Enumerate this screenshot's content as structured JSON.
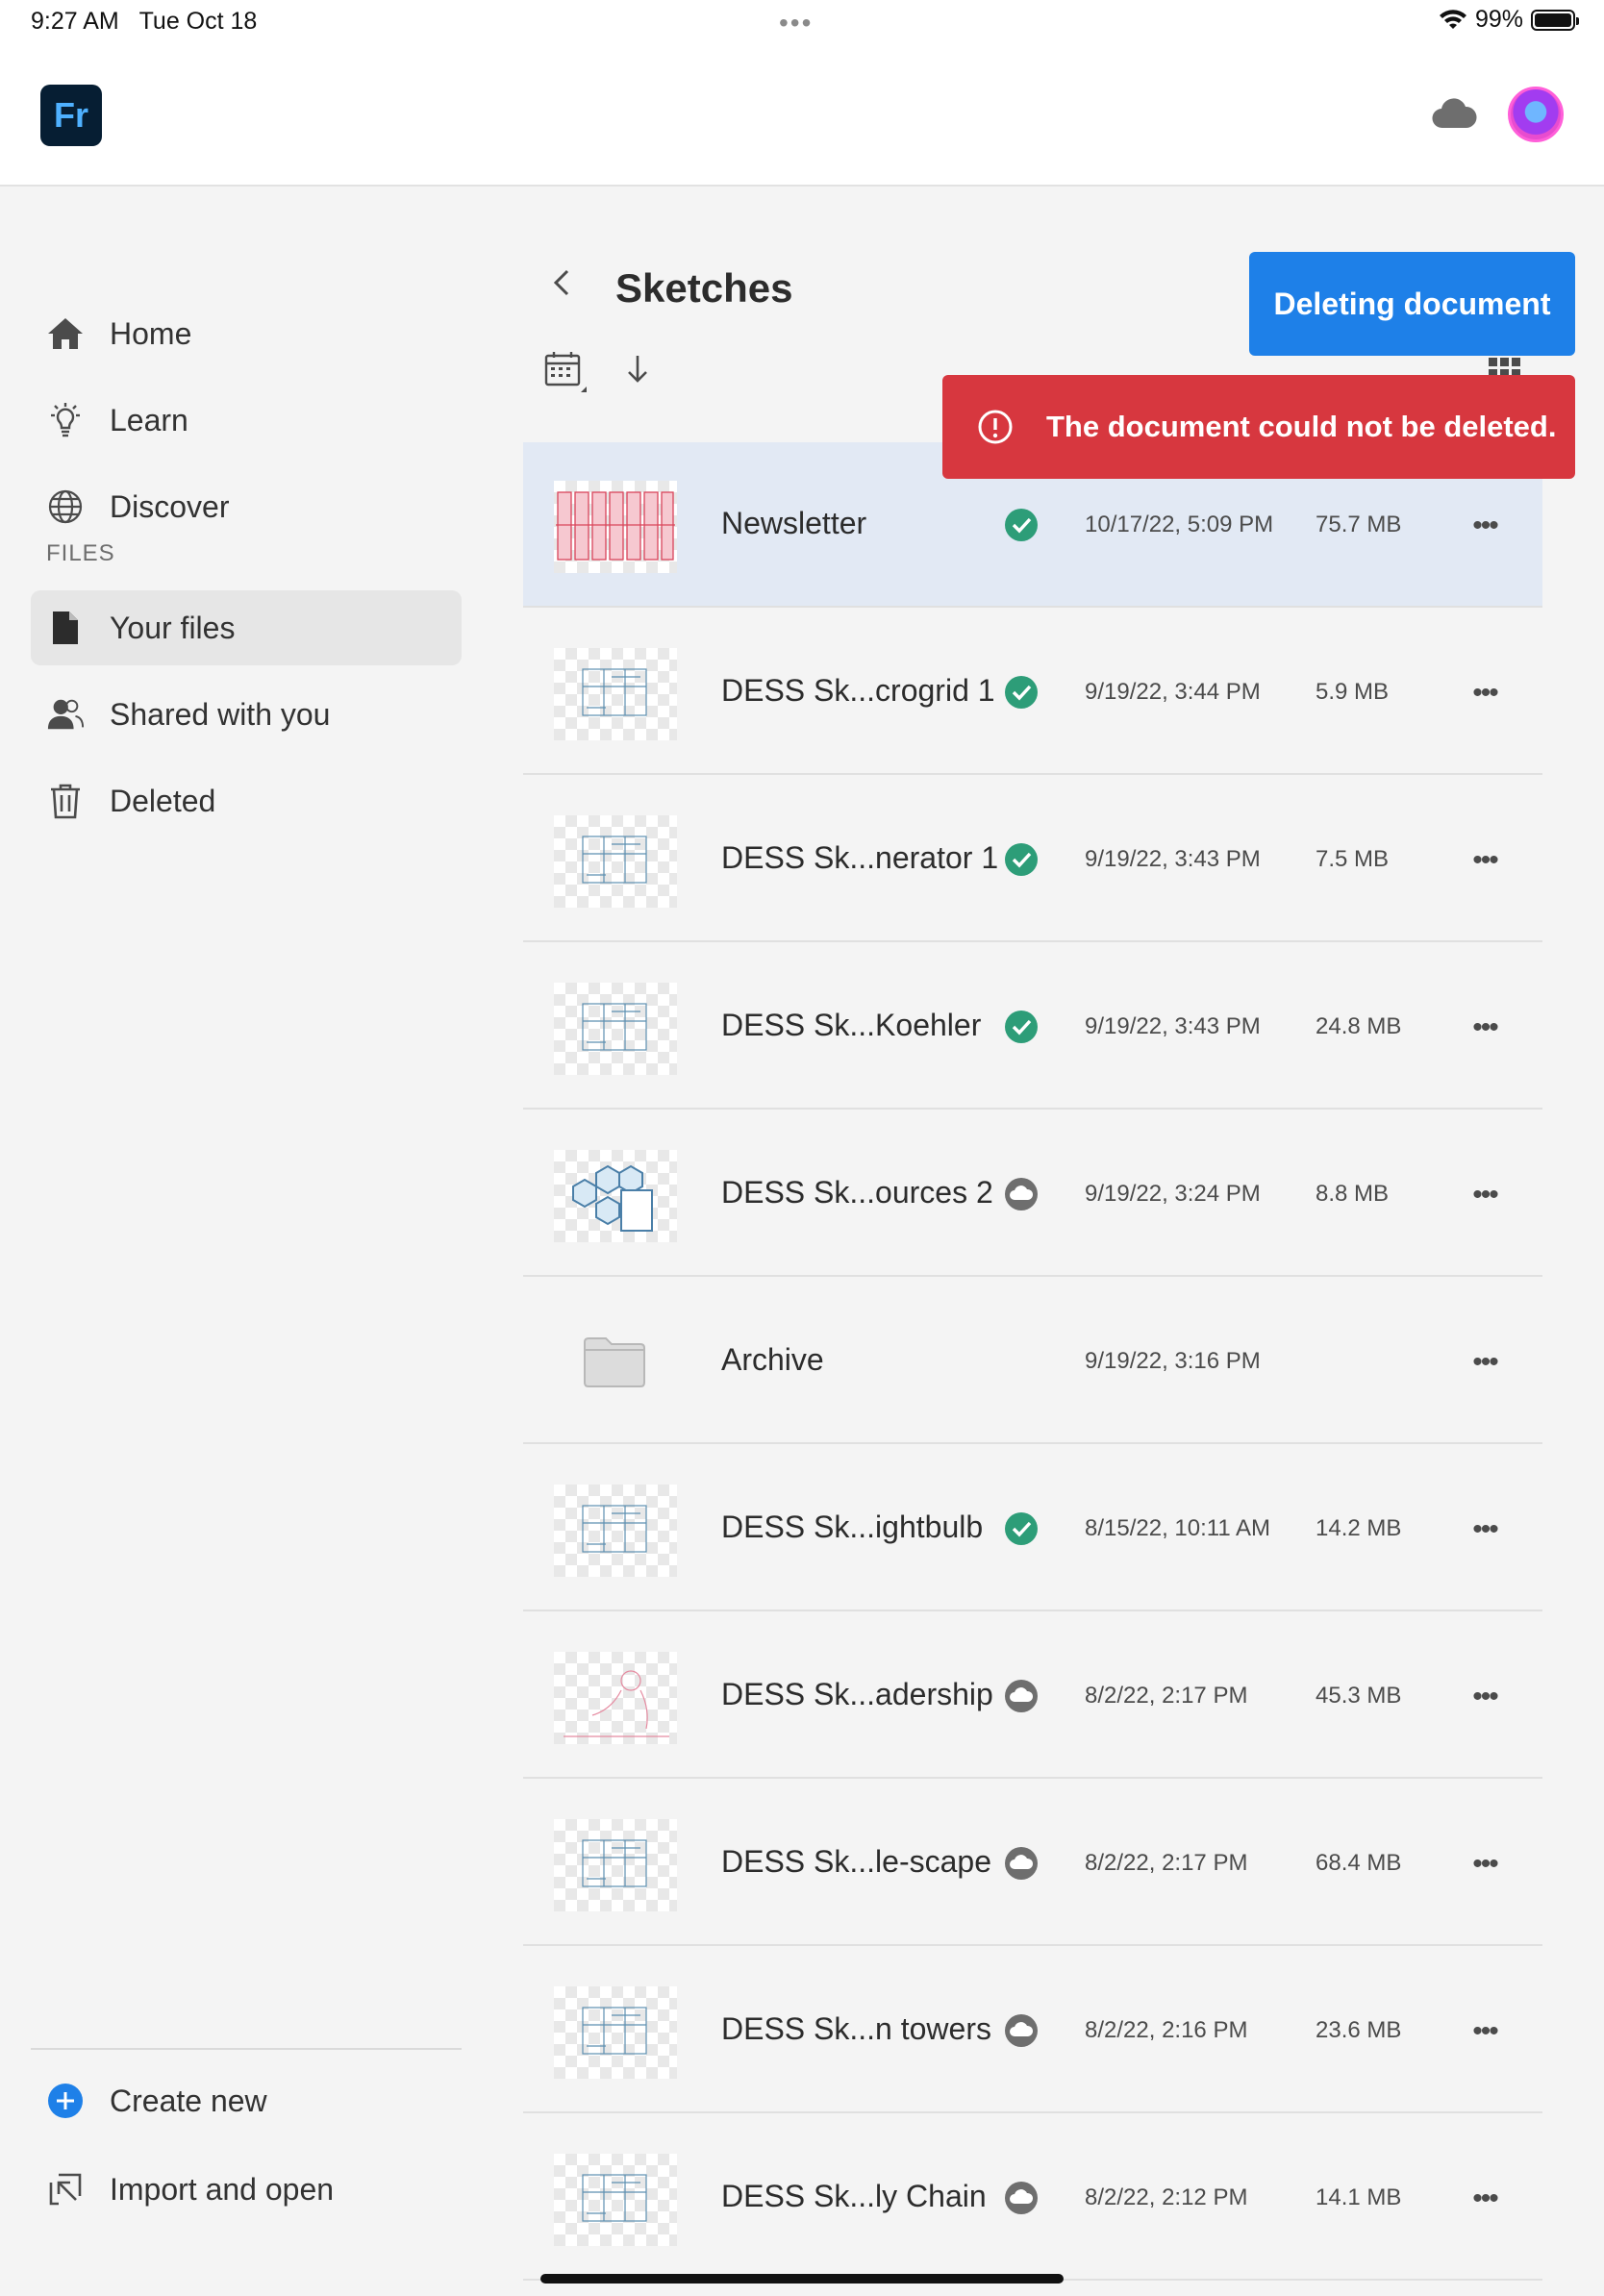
{
  "status_bar": {
    "time": "9:27 AM",
    "date": "Tue Oct 18",
    "dots": "•••",
    "battery": "99%",
    "icons": [
      "wifi-icon",
      "battery-icon"
    ]
  },
  "app": {
    "logo_text": "Fr",
    "cloud_icon": "cloud-icon",
    "avatar_icon": "user-avatar"
  },
  "sidebar": {
    "nav": [
      {
        "label": "Home",
        "icon": "home-icon"
      },
      {
        "label": "Learn",
        "icon": "lightbulb-icon"
      },
      {
        "label": "Discover",
        "icon": "globe-icon"
      }
    ],
    "files_header": "FILES",
    "files": [
      {
        "label": "Your files",
        "icon": "document-icon",
        "active": true
      },
      {
        "label": "Shared with you",
        "icon": "people-icon"
      },
      {
        "label": "Deleted",
        "icon": "trash-icon"
      }
    ],
    "bottom": [
      {
        "label": "Create new",
        "icon": "plus-circle-icon"
      },
      {
        "label": "Import and open",
        "icon": "import-icon"
      }
    ]
  },
  "main": {
    "title": "Sketches",
    "deleting_button": "Deleting document",
    "toast_message": "The document could not be deleted.",
    "more_label": "•••",
    "rows": [
      {
        "name": "Newsletter",
        "sync": "synced",
        "date": "10/17/22, 5:09 PM",
        "size": "75.7 MB",
        "thumb": "red"
      },
      {
        "name": "DESS Sk...crogrid 1",
        "sync": "synced",
        "date": "9/19/22, 3:44 PM",
        "size": "5.9 MB",
        "thumb": "blue"
      },
      {
        "name": "DESS Sk...nerator 1",
        "sync": "synced",
        "date": "9/19/22, 3:43 PM",
        "size": "7.5 MB",
        "thumb": "blue"
      },
      {
        "name": "DESS Sk...Koehler",
        "sync": "synced",
        "date": "9/19/22, 3:43 PM",
        "size": "24.8 MB",
        "thumb": "blue"
      },
      {
        "name": "DESS Sk...ources 2",
        "sync": "cloud",
        "date": "9/19/22, 3:24 PM",
        "size": "8.8 MB",
        "thumb": "hex"
      },
      {
        "name": "Archive",
        "sync": "",
        "date": "9/19/22, 3:16 PM",
        "size": "",
        "thumb": "folder"
      },
      {
        "name": "DESS Sk...ightbulb",
        "sync": "synced",
        "date": "8/15/22, 10:11 AM",
        "size": "14.2 MB",
        "thumb": "blue"
      },
      {
        "name": "DESS Sk...adership",
        "sync": "cloud",
        "date": "8/2/22, 2:17 PM",
        "size": "45.3 MB",
        "thumb": "pink"
      },
      {
        "name": "DESS Sk...le-scape",
        "sync": "cloud",
        "date": "8/2/22, 2:17 PM",
        "size": "68.4 MB",
        "thumb": "blue"
      },
      {
        "name": "DESS Sk...n towers",
        "sync": "cloud",
        "date": "8/2/22, 2:16 PM",
        "size": "23.6 MB",
        "thumb": "blue"
      },
      {
        "name": "DESS Sk...ly Chain",
        "sync": "cloud",
        "date": "8/2/22, 2:12 PM",
        "size": "14.1 MB",
        "thumb": "blue"
      }
    ]
  },
  "colors": {
    "accent": "#1e80e8",
    "error": "#d7373f",
    "synced": "#2d9d78",
    "selected_row": "#e2e9f4"
  }
}
